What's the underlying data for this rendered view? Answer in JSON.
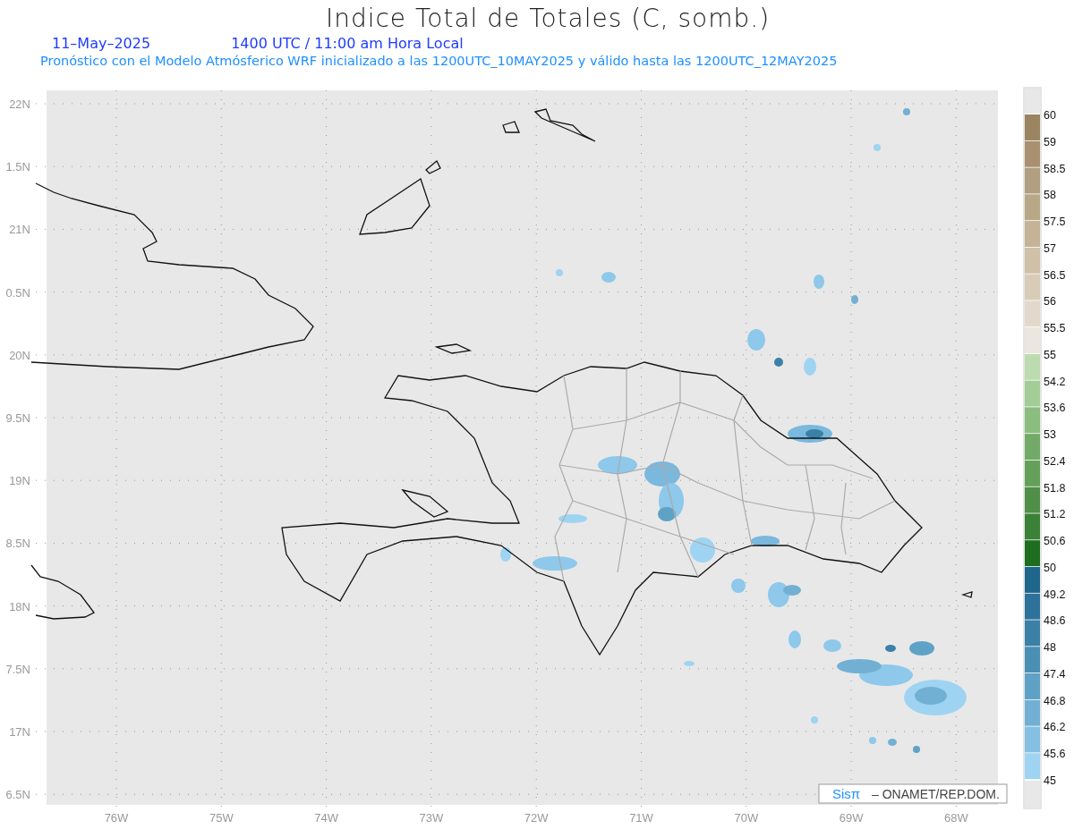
{
  "title": "Indice Total de Totales (C, somb.)",
  "date": "11–May–2025",
  "time": "1400 UTC / 11:00 am Hora Local",
  "subtitle": "Pronóstico con el Modelo Atmósferico WRF inicializado a las 1200UTC_10MAY2025 y válido hasta las  1200UTC_12MAY2025",
  "map": {
    "y_ticks": [
      "22N",
      "1.5N",
      "21N",
      "0.5N",
      "20N",
      "9.5N",
      "19N",
      "8.5N",
      "18N",
      "7.5N",
      "17N",
      "6.5N"
    ],
    "x_ticks": [
      "76W",
      "75W",
      "74W",
      "73W",
      "72W",
      "71W",
      "70W",
      "69W",
      "68W"
    ],
    "credit": {
      "logo": "Sisπ",
      "text": "– ONAMET/REP.DOM."
    }
  },
  "colorbar": {
    "labels": [
      "60",
      "59",
      "58.5",
      "58",
      "57.5",
      "57",
      "56.5",
      "56",
      "55.5",
      "55",
      "54.2",
      "53.6",
      "53",
      "52.4",
      "51.8",
      "51.2",
      "50.6",
      "50",
      "49.2",
      "48.6",
      "48",
      "47.4",
      "46.8",
      "46.2",
      "45.6",
      "45"
    ],
    "bins": [
      {
        "color": "#9b8560"
      },
      {
        "color": "#a89070"
      },
      {
        "color": "#b09f80"
      },
      {
        "color": "#b8a888"
      },
      {
        "color": "#c4b396"
      },
      {
        "color": "#cfc0a8"
      },
      {
        "color": "#d8ccb8"
      },
      {
        "color": "#e2d9cc"
      },
      {
        "color": "#ece7de"
      },
      {
        "color": "#bcdcb0"
      },
      {
        "color": "#a3cd96"
      },
      {
        "color": "#8abd7e"
      },
      {
        "color": "#72ab68"
      },
      {
        "color": "#64a05a"
      },
      {
        "color": "#4f8f48"
      },
      {
        "color": "#3a8236"
      },
      {
        "color": "#1d6e1e"
      },
      {
        "color": "#1e668c"
      },
      {
        "color": "#2d7299"
      },
      {
        "color": "#3a80a7"
      },
      {
        "color": "#4a8fb4"
      },
      {
        "color": "#5ea2c5"
      },
      {
        "color": "#72b0d3"
      },
      {
        "color": "#85c0e2"
      },
      {
        "color": "#9ed4f2"
      }
    ]
  }
}
